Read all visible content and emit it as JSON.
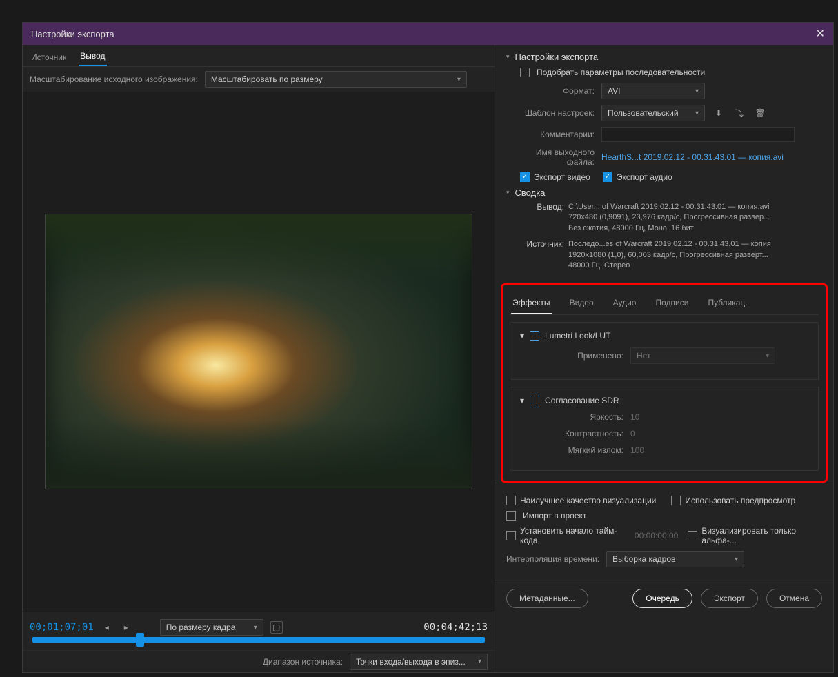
{
  "title": "Настройки экспорта",
  "left": {
    "tabs": {
      "source": "Источник",
      "output": "Вывод"
    },
    "scale_label": "Масштабирование исходного изображения:",
    "scale_value": "Масштабировать по размеру",
    "timecode": "00;01;07;01",
    "duration": "00;04;42;13",
    "fit_label": "По размеру кадра",
    "range_label": "Диапазон источника:",
    "range_value": "Точки входа/выхода в эпиз..."
  },
  "export": {
    "header": "Настройки экспорта",
    "match_seq": "Подобрать параметры последовательности",
    "format_label": "Формат:",
    "format_value": "AVI",
    "preset_label": "Шаблон настроек:",
    "preset_value": "Пользовательский",
    "comments_label": "Комментарии:",
    "outname_label": "Имя выходного файла:",
    "outname_value": "HearthS...t 2019.02.12 - 00.31.43.01 — копия.avi",
    "export_video": "Экспорт видео",
    "export_audio": "Экспорт аудио"
  },
  "summary": {
    "header": "Сводка",
    "out_label": "Вывод:",
    "out_text": "C:\\User... of Warcraft 2019.02.12 - 00.31.43.01 — копия.avi\n720x480 (0,9091), 23,976 кадр/с, Прогрессивная развер...\nБез сжатия, 48000 Гц, Моно, 16 бит",
    "src_label": "Источник:",
    "src_text": "Последо...es of Warcraft 2019.02.12 - 00.31.43.01 — копия\n1920x1080 (1,0), 60,003 кадр/с, Прогрессивная разверт...\n48000 Гц, Стерео"
  },
  "effects": {
    "tabs": {
      "fx": "Эффекты",
      "video": "Видео",
      "audio": "Аудио",
      "captions": "Подписи",
      "publish": "Публикац."
    },
    "lumetri": {
      "title": "Lumetri Look/LUT",
      "applied_label": "Применено:",
      "applied_value": "Нет"
    },
    "sdr": {
      "title": "Согласование SDR",
      "bright_label": "Яркость:",
      "bright_value": "10",
      "contrast_label": "Контрастность:",
      "contrast_value": "0",
      "soft_label": "Мягкий излом:",
      "soft_value": "100"
    }
  },
  "bottom": {
    "max_quality": "Наилучшее качество визуализации",
    "use_preview": "Использовать предпросмотр",
    "import_project": "Импорт в проект",
    "set_tc": "Установить начало тайм-кода",
    "tc_value": "00:00:00:00",
    "alpha_only": "Визуализировать только альфа-...",
    "interp_label": "Интерполяция времени:",
    "interp_value": "Выборка кадров"
  },
  "buttons": {
    "metadata": "Метаданные...",
    "queue": "Очередь",
    "export": "Экспорт",
    "cancel": "Отмена"
  }
}
